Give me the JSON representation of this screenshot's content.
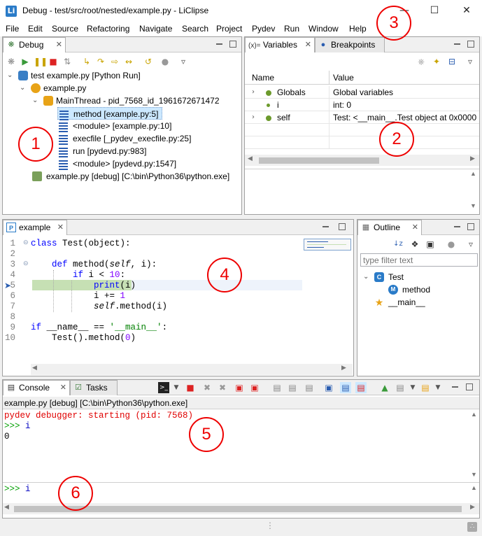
{
  "window": {
    "title": "Debug - test/src/root/nested/example.py - LiClipse",
    "icon": "Li"
  },
  "menu": [
    "File",
    "Edit",
    "Source",
    "Refactoring",
    "Navigate",
    "Search",
    "Project",
    "Pydev",
    "Run",
    "Window",
    "Help"
  ],
  "debug": {
    "tab_label": "Debug",
    "tree": [
      {
        "label": "test example.py [Python Run]"
      },
      {
        "label": "example.py"
      },
      {
        "label": "MainThread - pid_7568_id_1961672671472"
      },
      {
        "label": "method [example.py:5]"
      },
      {
        "label": "<module> [example.py:10]"
      },
      {
        "label": "execfile [_pydev_execfile.py:25]"
      },
      {
        "label": "run [pydevd.py:983]"
      },
      {
        "label": "<module> [pydevd.py:1547]"
      },
      {
        "label": "example.py [debug] [C:\\bin\\Python36\\python.exe]"
      }
    ]
  },
  "variables": {
    "tab_label": "Variables",
    "tab_prefix": "(x)=",
    "breakpoints_label": "Breakpoints",
    "col_name": "Name",
    "col_value": "Value",
    "rows": [
      {
        "name": "Globals",
        "value": "Global variables"
      },
      {
        "name": "i",
        "value": "int: 0"
      },
      {
        "name": "self",
        "value": "Test: <__main__.Test object at 0x000001C"
      }
    ]
  },
  "editor": {
    "tab_label": "example",
    "lines": [
      {
        "n": "1"
      },
      {
        "n": "2"
      },
      {
        "n": "3"
      },
      {
        "n": "4"
      },
      {
        "n": "5"
      },
      {
        "n": "6"
      },
      {
        "n": "7"
      },
      {
        "n": "8"
      },
      {
        "n": "9"
      },
      {
        "n": "10"
      }
    ]
  },
  "outline": {
    "tab_label": "Outline",
    "filter_placeholder": "type filter text",
    "items": [
      {
        "label": "Test"
      },
      {
        "label": "method"
      },
      {
        "label": "__main__"
      }
    ]
  },
  "console": {
    "tab_label": "Console",
    "tasks_label": "Tasks",
    "header": "example.py [debug] [C:\\bin\\Python36\\python.exe]",
    "line1": "pydev debugger: starting (pid: 7568)",
    "prompt": ">>>",
    "line2_cmd": "i",
    "line3": "0",
    "input_cmd": "i"
  },
  "annotations": [
    "1",
    "2",
    "3",
    "4",
    "5",
    "6"
  ],
  "colors": {
    "accent_red": "#e00000",
    "selection": "#cce8ff",
    "current_line": "#c6e0b4"
  }
}
